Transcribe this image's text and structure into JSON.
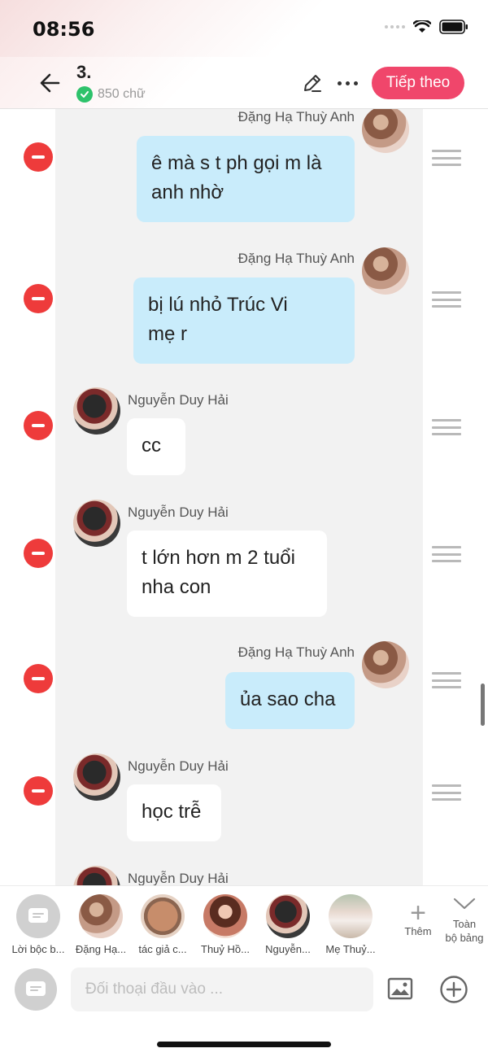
{
  "status_bar": {
    "time": "08:56"
  },
  "header": {
    "chapter_title": "3.",
    "word_count": "850 chữ",
    "next_label": "Tiếp theo"
  },
  "messages": [
    {
      "speaker": "Đặng Hạ Thuỳ Anh",
      "text": "ê mà s t ph gọi m là\nanh nhờ",
      "side": "right"
    },
    {
      "speaker": "Đặng Hạ Thuỳ Anh",
      "text": "bị lú nhỏ Trúc Vi\nmẹ r",
      "side": "right"
    },
    {
      "speaker": "Nguyễn Duy Hải",
      "text": "cc",
      "side": "left"
    },
    {
      "speaker": "Nguyễn Duy Hải",
      "text": "t lớn hơn m 2 tuổi\nnha con",
      "side": "left"
    },
    {
      "speaker": "Đặng Hạ Thuỳ Anh",
      "text": "ủa sao cha",
      "side": "right"
    },
    {
      "speaker": "Nguyễn Duy Hải",
      "text": "học trễ",
      "side": "left"
    },
    {
      "speaker": "Nguyễn Duy Hải",
      "text": "",
      "side": "left"
    }
  ],
  "characters": [
    {
      "label": "Lời bộc b...",
      "icon": "narrator-icon"
    },
    {
      "label": "Đặng Hạ...",
      "icon": "avatar-girl"
    },
    {
      "label": "tác giả c...",
      "icon": "avatar-blob"
    },
    {
      "label": "Thuỷ Hồ...",
      "icon": "avatar-woman"
    },
    {
      "label": "Nguyễn...",
      "icon": "avatar-boy"
    },
    {
      "label": "Mẹ Thuỷ...",
      "icon": "avatar-dress"
    }
  ],
  "char_bar": {
    "add_label": "Thêm",
    "all_label": "Toàn\nbộ bảng"
  },
  "input": {
    "placeholder": "Đối thoại đầu vào ..."
  },
  "colors": {
    "accent": "#f0466b",
    "bubble_blue": "#c9ecfb",
    "remove_red": "#ee3b3b"
  }
}
